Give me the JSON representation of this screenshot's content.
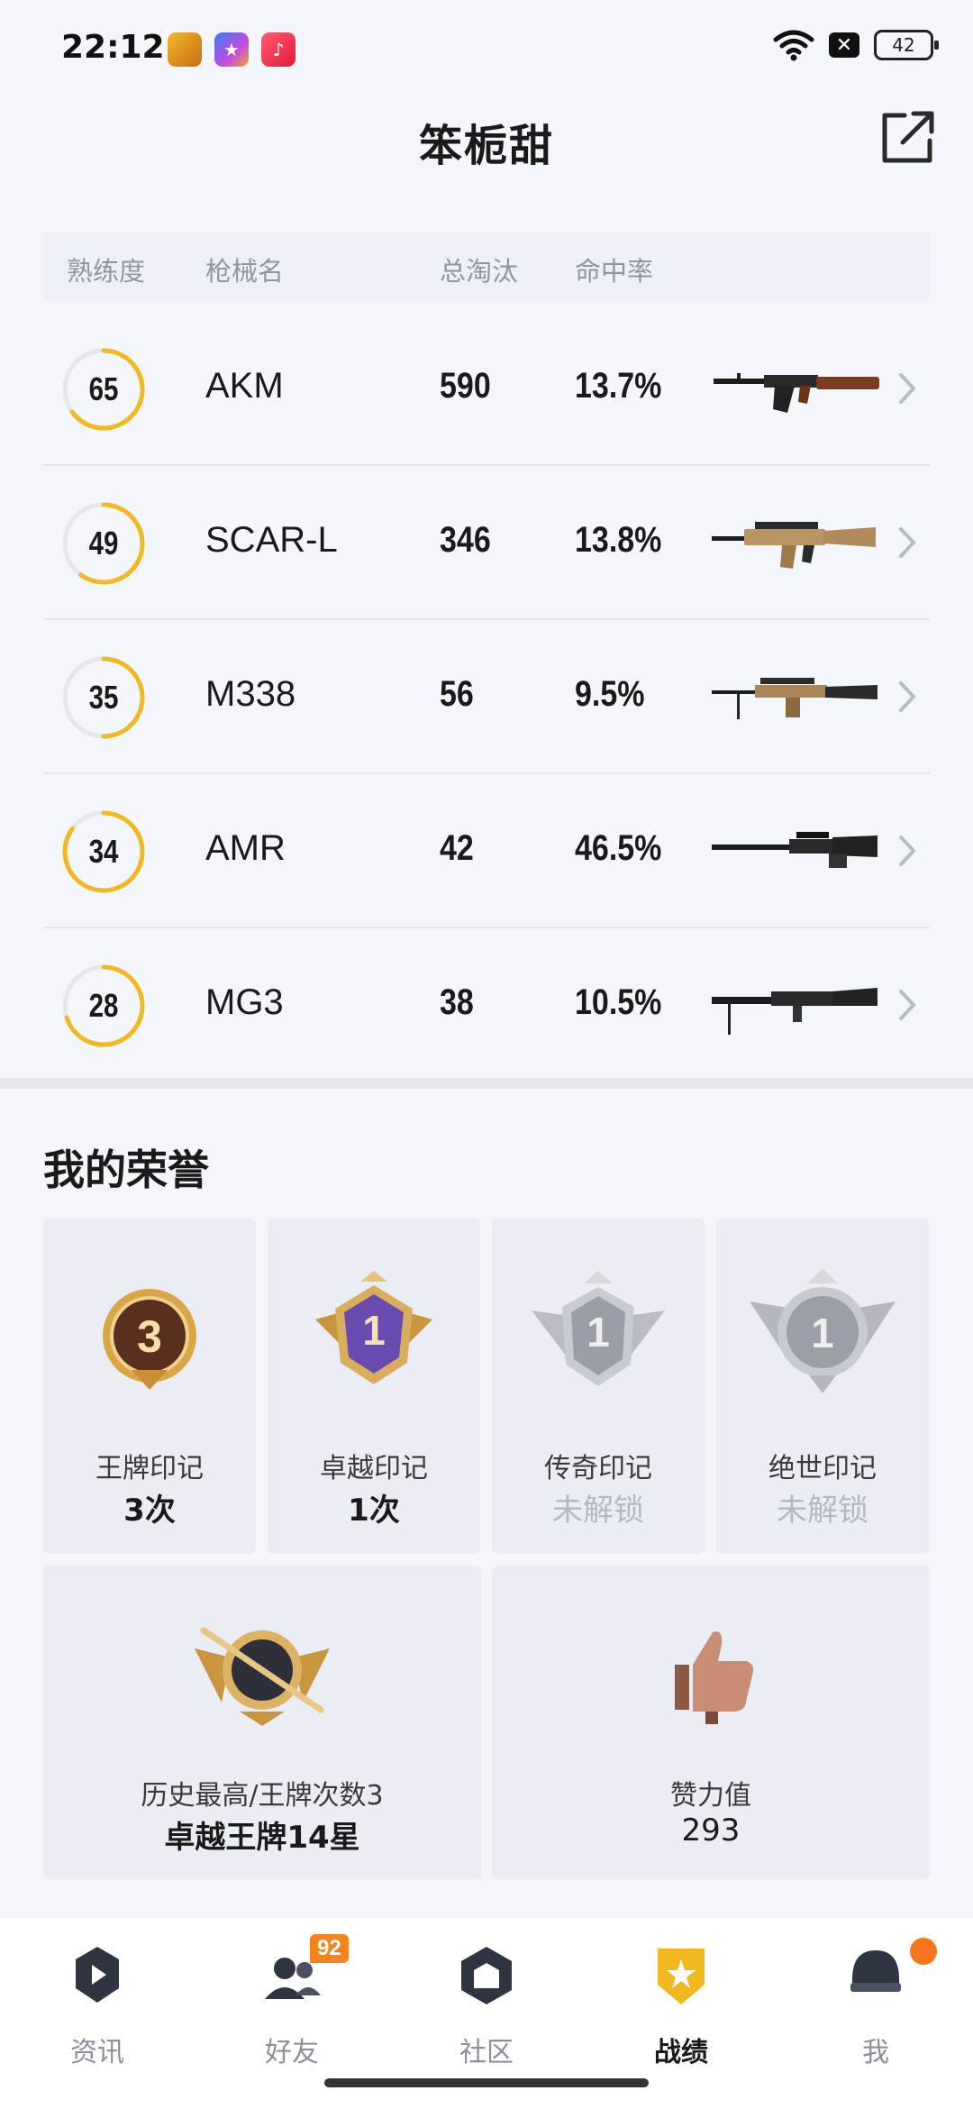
{
  "status": {
    "time": "22:12",
    "battery": "42",
    "apps": [
      "和平精英",
      "星",
      "音乐"
    ]
  },
  "header": {
    "title": "笨栀甜"
  },
  "table": {
    "headers": [
      "熟练度",
      "枪械名",
      "总淘汰",
      "命中率"
    ],
    "rows": [
      {
        "proficiency": 65,
        "name": "AKM",
        "kills": "590",
        "hit_rate": "13.7%",
        "progress": 0.65
      },
      {
        "proficiency": 49,
        "name": "SCAR-L",
        "kills": "346",
        "hit_rate": "13.8%",
        "progress": 0.6
      },
      {
        "proficiency": 35,
        "name": "M338",
        "kills": "56",
        "hit_rate": "9.5%",
        "progress": 0.5
      },
      {
        "proficiency": 34,
        "name": "AMR",
        "kills": "42",
        "hit_rate": "46.5%",
        "progress": 0.85
      },
      {
        "proficiency": 28,
        "name": "MG3",
        "kills": "38",
        "hit_rate": "10.5%",
        "progress": 0.7
      }
    ]
  },
  "honors": {
    "title": "我的荣誉",
    "cards": [
      {
        "label": "王牌印记",
        "value": "3次",
        "badge_num": "3",
        "locked": false
      },
      {
        "label": "卓越印记",
        "value": "1次",
        "badge_num": "1",
        "locked": false
      },
      {
        "label": "传奇印记",
        "value": "未解锁",
        "badge_num": "1",
        "locked": true
      },
      {
        "label": "绝世印记",
        "value": "未解锁",
        "badge_num": "1",
        "locked": true
      }
    ],
    "wide_cards": [
      {
        "label": "历史最高/王牌次数3",
        "value": "卓越王牌14星"
      },
      {
        "label": "赞力值",
        "value": "293"
      }
    ]
  },
  "nav": {
    "items": [
      {
        "label": "资讯",
        "icon": "news-icon",
        "active": false
      },
      {
        "label": "好友",
        "icon": "friends-icon",
        "active": false,
        "badge": "92"
      },
      {
        "label": "社区",
        "icon": "community-icon",
        "active": false
      },
      {
        "label": "战绩",
        "icon": "record-icon",
        "active": true
      },
      {
        "label": "我",
        "icon": "profile-icon",
        "active": false,
        "dot": true
      }
    ]
  },
  "colors": {
    "accent": "#f2b81f",
    "nav_badge": "#f5841f",
    "background": "#f3f6fb"
  }
}
